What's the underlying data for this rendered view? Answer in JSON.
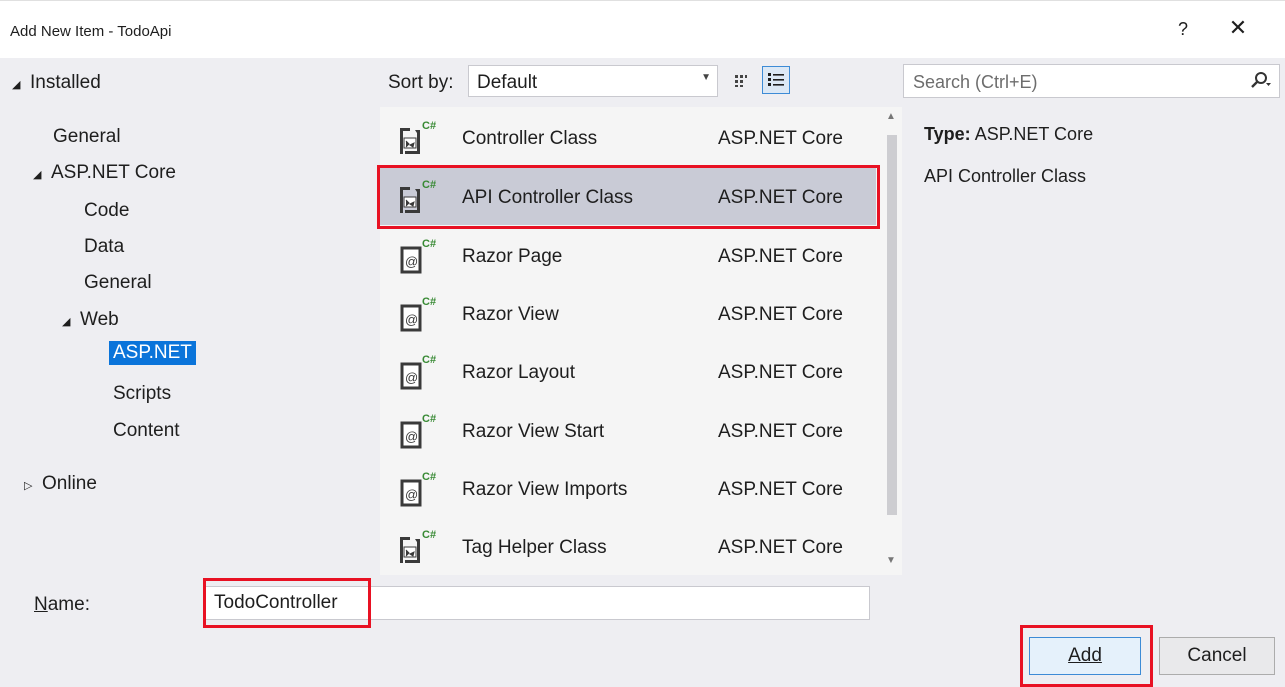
{
  "window": {
    "title": "Add New Item - TodoApi",
    "help_glyph": "?",
    "close_glyph": "✕"
  },
  "tree": {
    "installed": "Installed",
    "general": "General",
    "aspnet_core": "ASP.NET Core",
    "code": "Code",
    "data": "Data",
    "general2": "General",
    "web": "Web",
    "aspnet": "ASP.NET",
    "scripts": "Scripts",
    "content": "Content",
    "online": "Online"
  },
  "toolbar": {
    "sort_label": "Sort by:",
    "sort_value": "Default"
  },
  "search": {
    "placeholder": "Search (Ctrl+E)"
  },
  "templates": [
    {
      "name": "Controller Class",
      "category": "ASP.NET Core",
      "icon": "class-icon"
    },
    {
      "name": "API Controller Class",
      "category": "ASP.NET Core",
      "icon": "class-icon"
    },
    {
      "name": "Razor Page",
      "category": "ASP.NET Core",
      "icon": "razor-icon"
    },
    {
      "name": "Razor View",
      "category": "ASP.NET Core",
      "icon": "razor-icon"
    },
    {
      "name": "Razor Layout",
      "category": "ASP.NET Core",
      "icon": "razor-icon"
    },
    {
      "name": "Razor View Start",
      "category": "ASP.NET Core",
      "icon": "razor-icon"
    },
    {
      "name": "Razor View Imports",
      "category": "ASP.NET Core",
      "icon": "razor-icon"
    },
    {
      "name": "Tag Helper Class",
      "category": "ASP.NET Core",
      "icon": "class-icon"
    }
  ],
  "details": {
    "type_label": "Type:",
    "type_value": "ASP.NET Core",
    "description": "API Controller Class"
  },
  "footer": {
    "name_label": "Name:",
    "name_value": "TodoController",
    "add_label": "Add",
    "cancel_label": "Cancel"
  },
  "colors": {
    "highlight": "#e81123",
    "selection": "#0a74da",
    "csharp_badge": "#388a34"
  }
}
